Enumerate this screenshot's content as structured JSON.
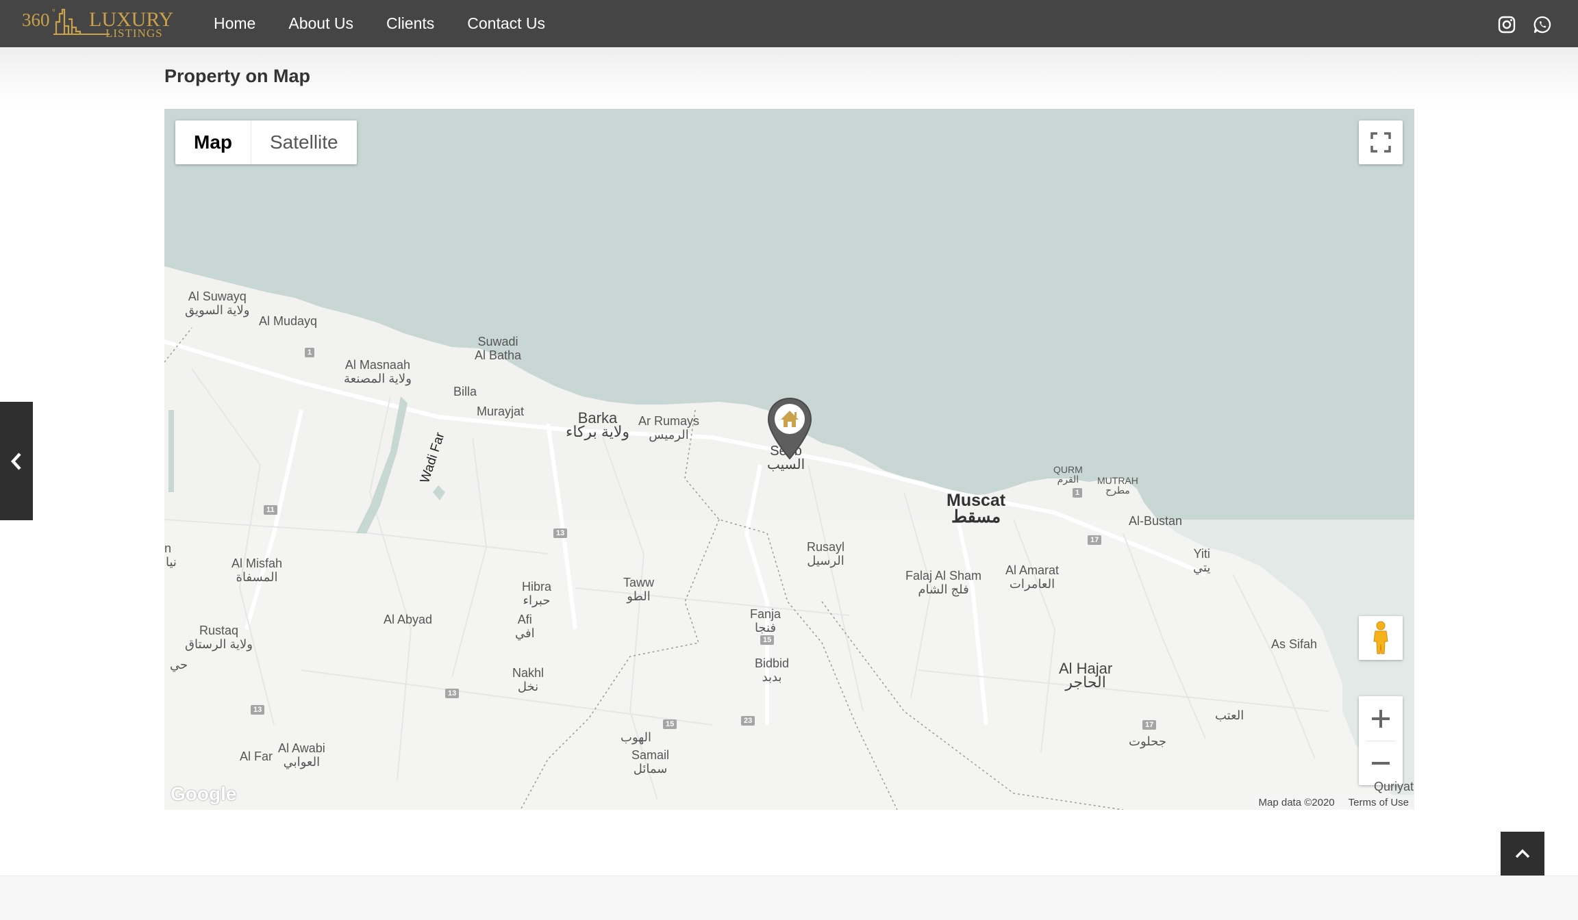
{
  "header": {
    "logo": {
      "number": "360",
      "degree": "°",
      "brand_top": "LUXURY",
      "brand_bottom": "LISTINGS",
      "color": "#c9a24a"
    },
    "nav": [
      {
        "label": "Home"
      },
      {
        "label": "About Us"
      },
      {
        "label": "Clients"
      },
      {
        "label": "Contact Us"
      }
    ],
    "social_icons": [
      "instagram-icon",
      "whatsapp-icon"
    ]
  },
  "section": {
    "title": "Property on Map"
  },
  "map": {
    "map_type": {
      "map_label": "Map",
      "satellite_label": "Satellite",
      "selected": "Map"
    },
    "controls": {
      "fullscreen": "fullscreen-icon",
      "pegman": "pegman-icon",
      "zoom_in": "+",
      "zoom_out": "−"
    },
    "attribution": {
      "map_data": "Map data ©2020",
      "terms": "Terms of Use",
      "logo": "Google"
    },
    "marker": {
      "icon": "house-icon",
      "color": "#c9a24a"
    },
    "labels": {
      "al_suwayq": "Al Suwayq",
      "al_suwayq_ar": "ولاية السويق",
      "al_mudayq": "Al Mudayq",
      "al_masnaah": "Al Masnaah",
      "al_masnaah_ar": "ولاية المصنعة",
      "suwadi": "Suwadi",
      "al_batha": "Al Batha",
      "billa": "Billa",
      "murayjat": "Murayjat",
      "barka": "Barka",
      "barka_ar": "ولاية بركاء",
      "ar_rumays": "Ar Rumays",
      "ar_rumays_ar": "الرميس",
      "seeb": "Seeb",
      "seeb_ar": "السيب",
      "wadi_far": "Wadi Far",
      "muscat": "Muscat",
      "muscat_ar": "مسقط",
      "qurm": "QURM",
      "qurm_ar": "القرم",
      "mutrah": "MUTRAH",
      "mutrah_ar": "مطرح",
      "al_bustan": "Al-Bustan",
      "yiti": "Yiti",
      "yiti_ar": "يتي",
      "rusayl": "Rusayl",
      "rusayl_ar": "الرسيل",
      "falaj": "Falaj Al Sham",
      "falaj_ar": "فلج الشام",
      "al_amarat": "Al Amarat",
      "al_amarat_ar": "العامرات",
      "al_misfah": "Al Misfah",
      "al_misfah_ar": "المسفاة",
      "hibra": "Hibra",
      "hibra_ar": "حبراء",
      "taww": "Taww",
      "taww_ar": "الطو",
      "fanja": "Fanja",
      "fanja_ar": "فنجا",
      "rustaq": "Rustaq",
      "rustaq_ar": "ولاية الرستاق",
      "al_abyad": "Al Abyad",
      "afi": "Afi",
      "afi_ar": "افي",
      "bidbid": "Bidbid",
      "bidbid_ar": "بدبد",
      "as_sifah": "As Sifah",
      "nakhl": "Nakhl",
      "nakhl_ar": "نخل",
      "al_hajar": "Al Hajar",
      "al_hajar_ar": "الحاجر",
      "al_hob_ar": "الهوب",
      "samail": "Samail",
      "samail_ar": "سمائل",
      "al_atab_ar": "العتب",
      "jahloot_ar": "جحلوت",
      "al_far": "Al Far",
      "al_awabi": "Al Awabi",
      "al_awabi_ar": "العوابي",
      "qurayyat": "Quriyat",
      "edge_n": "n",
      "edge_ar1": "نيا",
      "edge_ar2": "حي"
    },
    "shields": [
      "1",
      "11",
      "13",
      "13",
      "13",
      "15",
      "15",
      "23",
      "1",
      "17",
      "17"
    ]
  },
  "side_tab": {
    "icon": "chevron-left-icon"
  },
  "back_to_top": {
    "icon": "chevron-up-icon"
  }
}
